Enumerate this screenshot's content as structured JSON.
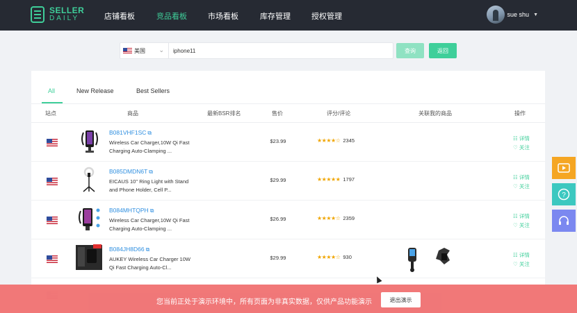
{
  "nav": {
    "logo_line1": "SELLER",
    "logo_line2": "DAILY",
    "items": [
      {
        "label": "店铺看板",
        "active": false
      },
      {
        "label": "竞品看板",
        "active": true
      },
      {
        "label": "市场看板",
        "active": false
      },
      {
        "label": "库存管理",
        "active": false
      },
      {
        "label": "授权管理",
        "active": false
      }
    ],
    "user_name": "sue shu"
  },
  "search": {
    "country": "美国",
    "query_value": "iphone11",
    "query_button": "查询",
    "back_button": "返回"
  },
  "tabs": [
    {
      "label": "All",
      "active": true
    },
    {
      "label": "New Release",
      "active": false
    },
    {
      "label": "Best Sellers",
      "active": false
    }
  ],
  "table": {
    "headers": [
      "站点",
      "商品",
      "最新BSR排名",
      "售价",
      "评分/评论",
      "关联我的商品",
      "操作"
    ],
    "rows": [
      {
        "asin": "B081VHF1SC",
        "name": "Wireless Car Charger,10W Qi Fast Charging Auto-Clamping ...",
        "price": "$23.99",
        "stars": "★★★★☆",
        "reviews": "2345"
      },
      {
        "asin": "B085DMDN6T",
        "name": "EICAUS 10'' Ring Light with Stand and Phone Holder, Cell P...",
        "price": "$29.99",
        "stars": "★★★★★",
        "reviews": "1797"
      },
      {
        "asin": "B084MHTQPH",
        "name": "Wireless Car Charger,10W Qi Fast Charging Auto-Clamping ...",
        "price": "$26.99",
        "stars": "★★★★☆",
        "reviews": "2359"
      },
      {
        "asin": "B084JH8D66",
        "name": "AUKEY Wireless Car Charger 10W Qi Fast Charging Auto-Cl...",
        "price": "$29.99",
        "stars": "★★★★☆",
        "reviews": "930"
      }
    ],
    "action_detail": "详情",
    "action_follow": "关注"
  },
  "banner": {
    "text": "您当前正处于演示环境中，所有页面为非真实数据，仅供产品功能演示",
    "exit_button": "退出演示"
  },
  "colors": {
    "accent": "#3fcf9a",
    "nav_bg": "#262a33",
    "link": "#2f8fe0",
    "banner": "#f17474",
    "side_orange": "#f5a623",
    "side_teal": "#3cc8c0",
    "side_purple": "#7b88f0"
  }
}
